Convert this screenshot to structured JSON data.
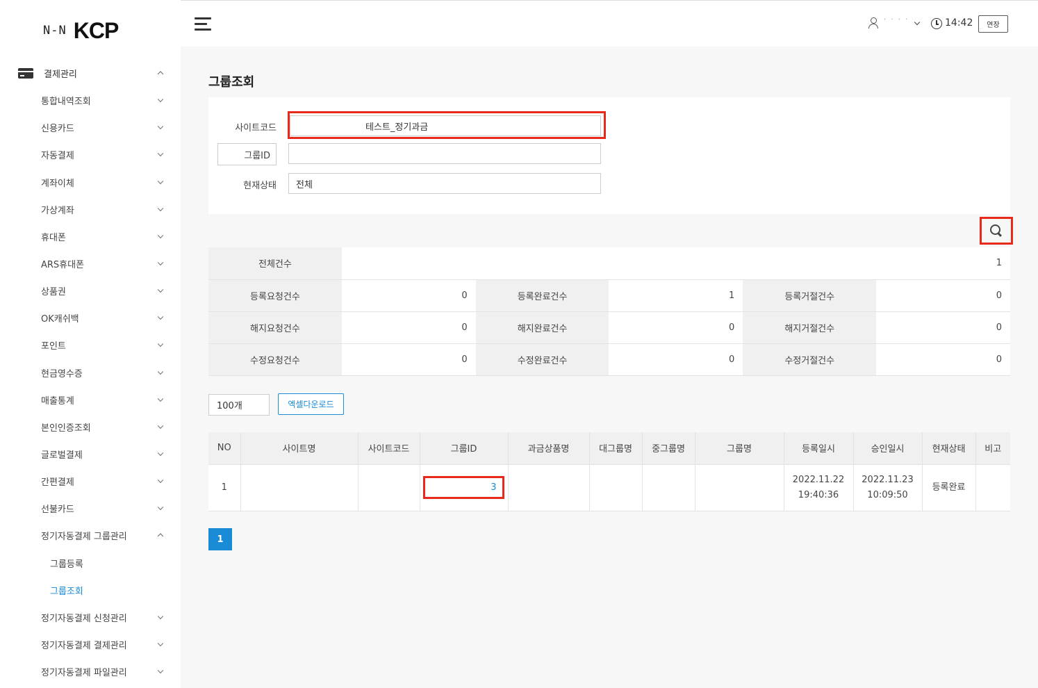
{
  "logo": {
    "brand_left": "N-N",
    "brand_right": "KCP"
  },
  "sidebar": {
    "top": {
      "label": "결제관리",
      "icon": "credit-card-icon"
    },
    "items": [
      {
        "label": "통합내역조회"
      },
      {
        "label": "신용카드"
      },
      {
        "label": "자동결제"
      },
      {
        "label": "계좌이체"
      },
      {
        "label": "가상계좌"
      },
      {
        "label": "휴대폰"
      },
      {
        "label": "ARS휴대폰"
      },
      {
        "label": "상품권"
      },
      {
        "label": "OK캐쉬백"
      },
      {
        "label": "포인트"
      },
      {
        "label": "현금영수증"
      },
      {
        "label": "매출통계"
      },
      {
        "label": "본인인증조회"
      },
      {
        "label": "글로벌결제"
      },
      {
        "label": "간편결제"
      },
      {
        "label": "선불카드"
      },
      {
        "label": "정기자동결제 그룹관리"
      }
    ],
    "sub_items": [
      {
        "label": "그룹등록"
      },
      {
        "label": "그룹조회"
      }
    ],
    "bottom_items": [
      {
        "label": "정기자동결제 신청관리"
      },
      {
        "label": "정기자동결제 결제관리"
      },
      {
        "label": "정기자동결제 파일관리"
      }
    ]
  },
  "header": {
    "user_name": "· · · ·",
    "time": "14:42",
    "extend_label": "연장"
  },
  "page": {
    "title": "그룹조회"
  },
  "search": {
    "site_code_label": "사이트코드",
    "site_code_value": "테스트_정기과금",
    "group_id_label": "그룹ID",
    "group_id_value": "",
    "status_label": "현재상태",
    "status_value": "전체"
  },
  "summary": {
    "total_label": "전체건수",
    "total_value": "1",
    "rows": [
      [
        {
          "label": "등록요청건수",
          "value": "0"
        },
        {
          "label": "등록완료건수",
          "value": "1"
        },
        {
          "label": "등록거절건수",
          "value": "0"
        }
      ],
      [
        {
          "label": "해지요청건수",
          "value": "0"
        },
        {
          "label": "해지완료건수",
          "value": "0"
        },
        {
          "label": "해지거절건수",
          "value": "0"
        }
      ],
      [
        {
          "label": "수정요청건수",
          "value": "0"
        },
        {
          "label": "수정완료건수",
          "value": "0"
        },
        {
          "label": "수정거절건수",
          "value": "0"
        }
      ]
    ]
  },
  "controls": {
    "page_size": "100개",
    "excel_label": "엑셀다운로드"
  },
  "table": {
    "headers": [
      "NO",
      "사이트명",
      "사이트코드",
      "그룹ID",
      "과금상품명",
      "대그룹명",
      "중그룹명",
      "그룹명",
      "등록일시",
      "승인일시",
      "현재상태",
      "비고"
    ],
    "rows": [
      {
        "no": "1",
        "site_name": "",
        "site_code": "",
        "group_id": "3",
        "product": "",
        "large_group": "",
        "mid_group": "",
        "group_name": "",
        "reg_date": "2022.11.22",
        "reg_time": "19:40:36",
        "appr_date": "2022.11.23",
        "appr_time": "10:09:50",
        "status": "등록완료",
        "note": ""
      }
    ]
  },
  "pagination": {
    "current": "1"
  },
  "colors": {
    "accent": "#1a8bd6",
    "highlight": "#e8291c"
  }
}
